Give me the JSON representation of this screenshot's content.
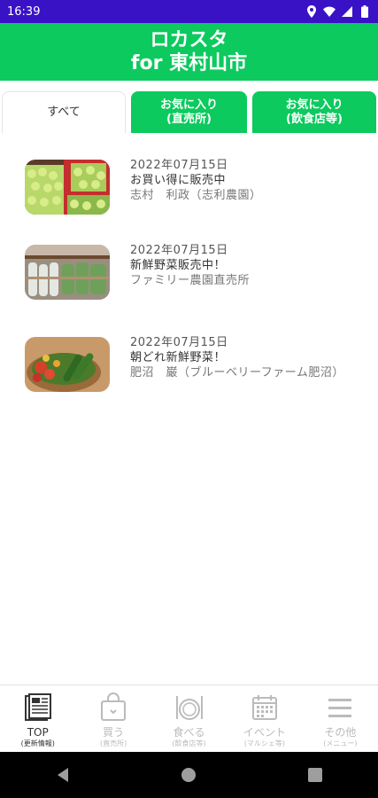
{
  "status_bar": {
    "time": "16:39",
    "icons": [
      "location-icon",
      "wifi-icon",
      "signal-icon",
      "battery-icon"
    ]
  },
  "header": {
    "title_line1": "ロカスタ",
    "title_line2": "for 東村山市",
    "color": "#0cca5e"
  },
  "tabs": [
    {
      "label_line1": "すべて",
      "label_line2": "",
      "active": true
    },
    {
      "label_line1": "お気に入り",
      "label_line2": "(直売所)",
      "active": false
    },
    {
      "label_line1": "お気に入り",
      "label_line2": "(飲食店等)",
      "active": false
    }
  ],
  "feed": [
    {
      "date": "2022年07月15日",
      "heading": "お買い得に販売中",
      "shop": "志村　利政（志利農園）",
      "image": "green-fruit-crates"
    },
    {
      "date": "2022年07月15日",
      "heading": "新鮮野菜販売中！",
      "shop": "ファミリー農園直売所",
      "image": "vegetable-shelves"
    },
    {
      "date": "2022年07月15日",
      "heading": "朝どれ新鮮野菜！",
      "shop": "肥沼　巌（ブルーベリーファーム肥沼）",
      "image": "vegetable-basket"
    }
  ],
  "bottom_nav": [
    {
      "label": "TOP",
      "sub": "(更新情報)",
      "icon": "newspaper-icon",
      "active": true
    },
    {
      "label": "買う",
      "sub": "(直売所)",
      "icon": "shopping-bag-icon",
      "active": false
    },
    {
      "label": "食べる",
      "sub": "(飲食店等)",
      "icon": "plate-cutlery-icon",
      "active": false
    },
    {
      "label": "イベント",
      "sub": "(マルシェ等)",
      "icon": "calendar-icon",
      "active": false
    },
    {
      "label": "その他",
      "sub": "(メニュー)",
      "icon": "menu-icon",
      "active": false
    }
  ],
  "system_nav": [
    "back-icon",
    "home-icon",
    "recents-icon"
  ]
}
